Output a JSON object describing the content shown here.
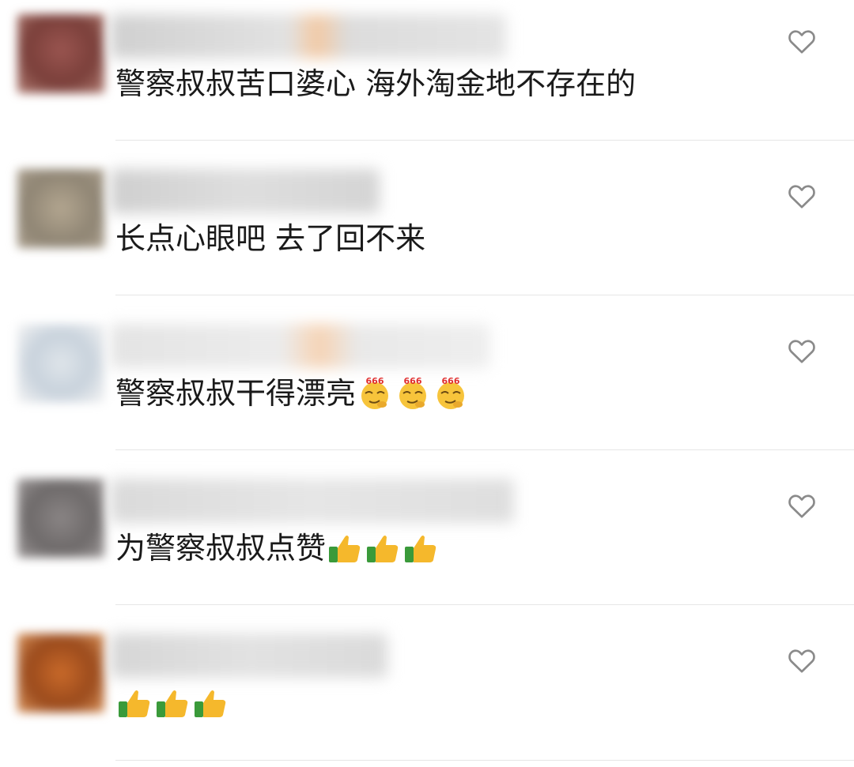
{
  "comments": [
    {
      "avatar_color": "#8a4a44",
      "username_color": "#d8d8d8",
      "username": "",
      "text": "警察叔叔苦口婆心 海外淘金地不存在的",
      "emojis": [],
      "emoji_icon": ""
    },
    {
      "avatar_color": "#9a8f7f",
      "username_color": "#d2d2d2",
      "username": "",
      "text": "长点心眼吧 去了回不来",
      "emojis": [],
      "emoji_icon": ""
    },
    {
      "avatar_color": "#cfd6de",
      "username_color": "#e6e1db",
      "username": "",
      "text": "警察叔叔干得漂亮",
      "emojis": [
        "666-emoji",
        "666-emoji",
        "666-emoji"
      ],
      "emoji_icon": "666-emoji"
    },
    {
      "avatar_color": "#7a7676",
      "username_color": "#e0e0e0",
      "username": "",
      "text": "为警察叔叔点赞",
      "emojis": [
        "thumbs-up-emoji",
        "thumbs-up-emoji",
        "thumbs-up-emoji"
      ],
      "emoji_icon": "thumbs-up-emoji"
    },
    {
      "avatar_color": "#b4581f",
      "username_color": "#dcdcdc",
      "username": "",
      "text": "",
      "emojis": [
        "thumbs-up-emoji",
        "thumbs-up-emoji",
        "thumbs-up-emoji"
      ],
      "emoji_icon": "thumbs-up-emoji"
    }
  ],
  "like_icon": "heart-outline-icon",
  "colors": {
    "text": "#1a1a1a",
    "divider": "#e6e6e6",
    "like": "#8a8a8a"
  }
}
